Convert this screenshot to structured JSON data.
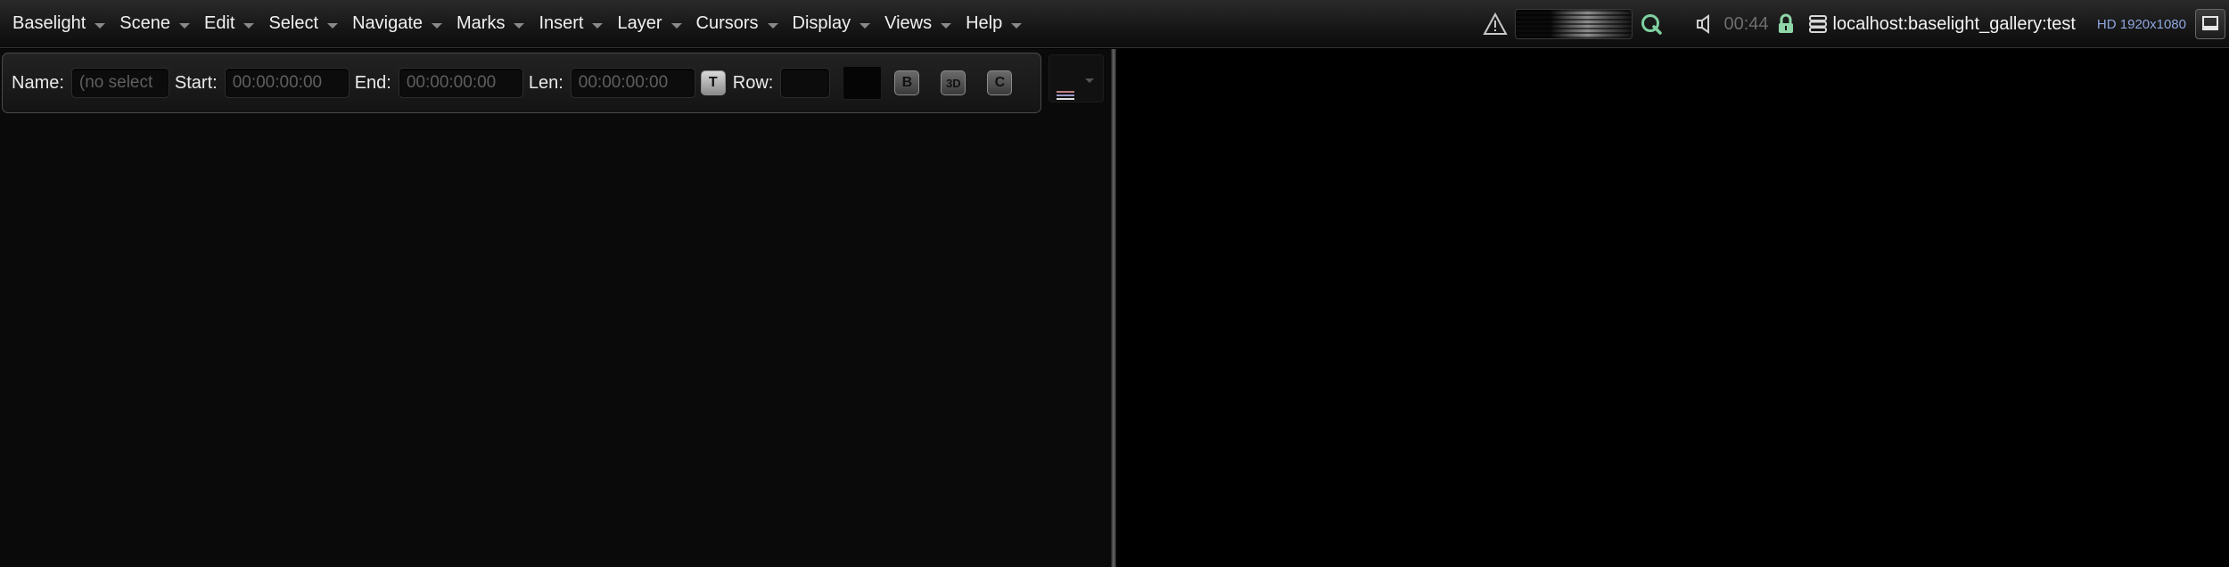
{
  "menubar": {
    "items": [
      {
        "label": "Baselight"
      },
      {
        "label": "Scene"
      },
      {
        "label": "Edit"
      },
      {
        "label": "Select"
      },
      {
        "label": "Navigate"
      },
      {
        "label": "Marks"
      },
      {
        "label": "Insert"
      },
      {
        "label": "Layer"
      },
      {
        "label": "Cursors"
      },
      {
        "label": "Display"
      },
      {
        "label": "Views"
      },
      {
        "label": "Help"
      }
    ]
  },
  "status": {
    "time": "00:44",
    "host": "localhost:baselight_gallery:test",
    "format": "HD 1920x1080",
    "icons": [
      "warning-icon",
      "render-meter",
      "q-icon",
      "speaker-icon",
      "lock-icon",
      "database-icon",
      "monitor-icon"
    ],
    "colors": {
      "q_icon": "#7fd0a0",
      "lock_icon": "#8fd6a8",
      "format_text": "#8fa6e0"
    }
  },
  "toolbar": {
    "name_label": "Name:",
    "name_placeholder": "(no select",
    "start_label": "Start:",
    "start_value": "00:00:00:00",
    "end_label": "End:",
    "end_value": "00:00:00:00",
    "len_label": "Len:",
    "len_value": "00:00:00:00",
    "t_button": "T",
    "row_label": "Row:",
    "row_value": "",
    "b_button": "B",
    "3d_button": "3D",
    "c_button": "C"
  }
}
